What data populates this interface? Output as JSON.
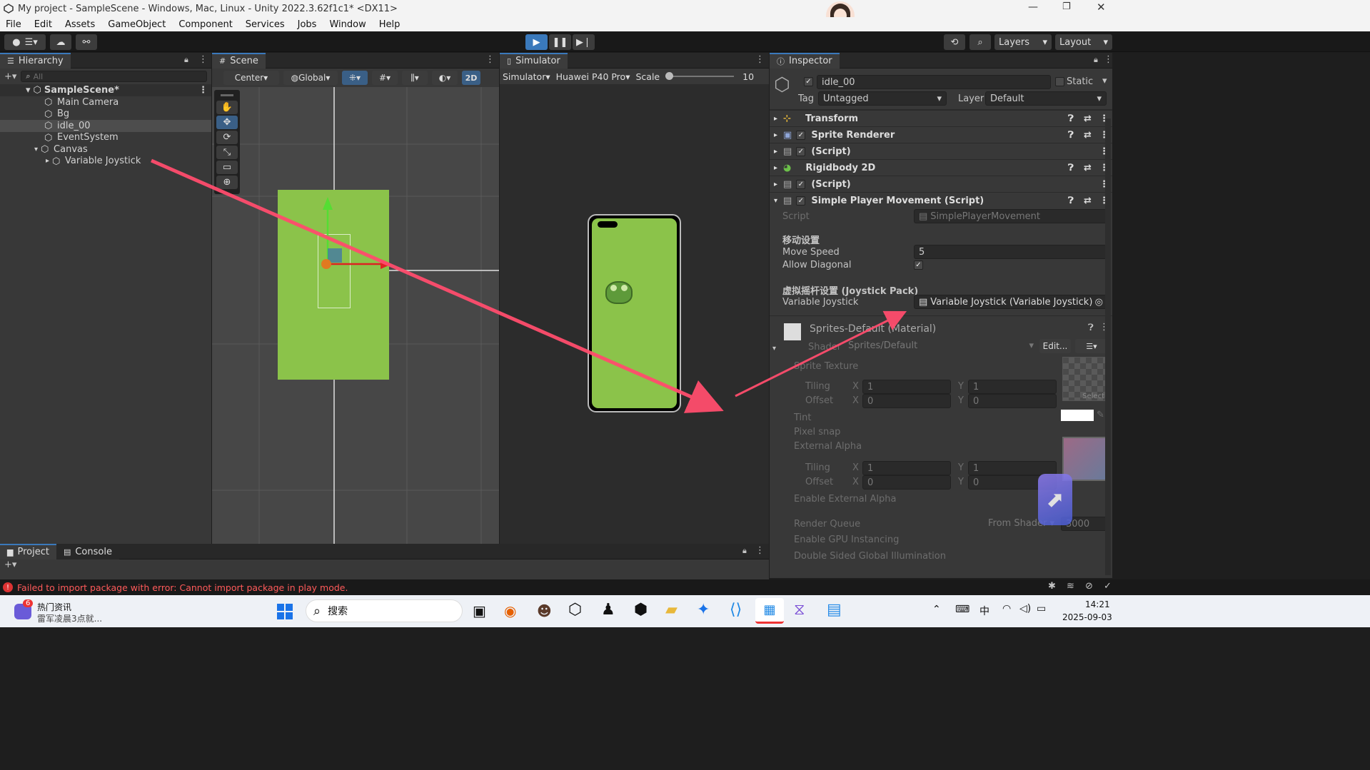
{
  "window": {
    "title": "My project - SampleScene - Windows, Mac, Linux - Unity 2022.3.62f1c1* <DX11>"
  },
  "menu": [
    "File",
    "Edit",
    "Assets",
    "GameObject",
    "Component",
    "Services",
    "Jobs",
    "Window",
    "Help"
  ],
  "toolbar": {
    "layers_label": "Layers",
    "layout_label": "Layout"
  },
  "hierarchy": {
    "tab": "Hierarchy",
    "search_placeholder": "All",
    "scene": "SampleScene*",
    "items": [
      "Main Camera",
      "Bg",
      "idle_00",
      "EventSystem",
      "Canvas",
      "Variable Joystick"
    ]
  },
  "scene": {
    "tab": "Scene",
    "pivot": "Center",
    "space": "Global",
    "mode2d": "2D"
  },
  "simulator": {
    "tab": "Simulator",
    "mode": "Simulator",
    "device": "Huawei P40 Pro",
    "scale_label": "Scale",
    "scale_value": "10"
  },
  "inspector": {
    "tab": "Inspector",
    "object_name": "idle_00",
    "static_label": "Static",
    "tag_label": "Tag",
    "tag_value": "Untagged",
    "layer_label": "Layer",
    "layer_value": "Default",
    "components": [
      "Transform",
      "Sprite Renderer",
      "(Script)",
      "Rigidbody 2D",
      "(Script)",
      "Simple Player Movement (Script)"
    ],
    "script_label": "Script",
    "script_value": "SimplePlayerMovement",
    "move_header": "移动设置",
    "move_speed_label": "Move Speed",
    "move_speed_value": "5",
    "allow_diag_label": "Allow Diagonal",
    "joystick_header": "虚拟摇杆设置 (Joystick Pack)",
    "joystick_label": "Variable Joystick",
    "joystick_value": "Variable Joystick (Variable Joystick)",
    "material_name": "Sprites-Default (Material)",
    "shader_label": "Shader",
    "shader_value": "Sprites/Default",
    "edit_label": "Edit...",
    "sprite_texture": "Sprite Texture",
    "tiling": "Tiling",
    "offset": "Offset",
    "x": "X",
    "y": "Y",
    "tiling_x": "1",
    "tiling_y": "1",
    "offset_x": "0",
    "offset_y": "0",
    "select_label": "Select",
    "tint": "Tint",
    "pixel_snap": "Pixel snap",
    "external_alpha": "External Alpha",
    "enable_ext_alpha": "Enable External Alpha",
    "render_queue": "Render Queue",
    "render_queue_mode": "From Shader",
    "render_queue_value": "3000",
    "gpu_instancing": "Enable GPU Instancing",
    "double_sided": "Double Sided Global Illumination"
  },
  "bottom": {
    "project_tab": "Project",
    "console_tab": "Console",
    "error": "Failed to import package with error: Cannot import package in play mode."
  },
  "taskbar": {
    "news_badge": "6",
    "news_title": "热门资讯",
    "news_sub": "雷军凌晨3点就...",
    "search": "搜索",
    "ime": "中",
    "time": "14:21",
    "date": "2025-09-03"
  },
  "colors": {
    "accent": "#3a79bb",
    "scene_green": "#8bc34a",
    "arrow": "#ff4d6d",
    "error": "#ff5a5a"
  }
}
